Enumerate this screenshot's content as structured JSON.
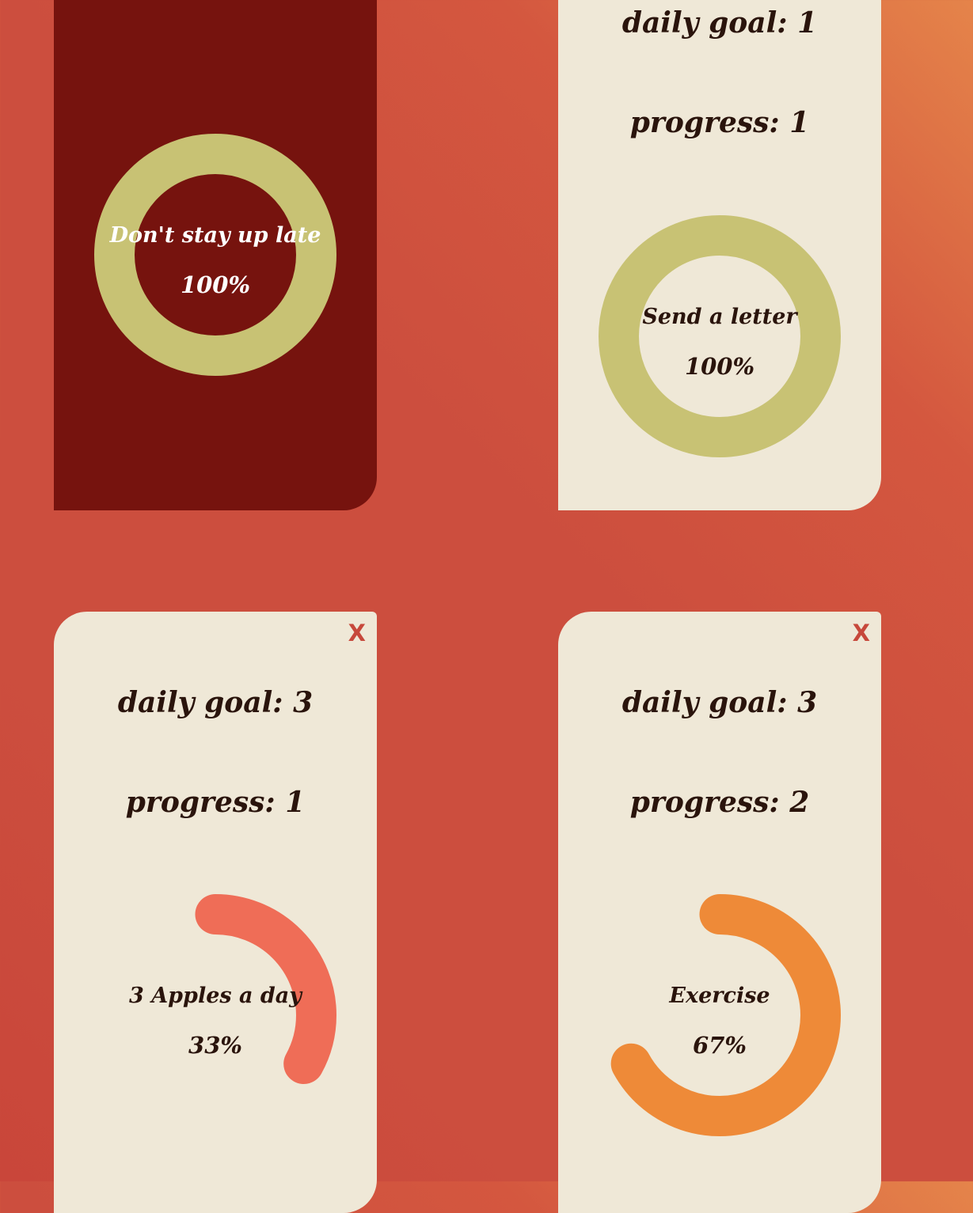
{
  "colors": {
    "dark_card": "#76130e",
    "light_card": "#efe8d7",
    "complete_ring": "#c8c274",
    "apples_ring": "#ef6d57",
    "exercise_ring": "#ee8a38",
    "close_button": "#c7483b"
  },
  "cards": [
    {
      "habit": "Don't stay up late",
      "percent_label": "100%",
      "progress": 1.0
    },
    {
      "goal_text": "daily goal: 1",
      "progress_text": "progress: 1",
      "habit": "Send a letter",
      "percent_label": "100%",
      "progress": 1.0
    },
    {
      "close_label": "X",
      "goal_text": "daily goal: 3",
      "progress_text": "progress: 1",
      "habit": "3 Apples a day",
      "percent_label": "33%",
      "progress": 0.33
    },
    {
      "close_label": "X",
      "goal_text": "daily goal: 3",
      "progress_text": "progress: 2",
      "habit": "Exercise",
      "percent_label": "67%",
      "progress": 0.67
    }
  ]
}
